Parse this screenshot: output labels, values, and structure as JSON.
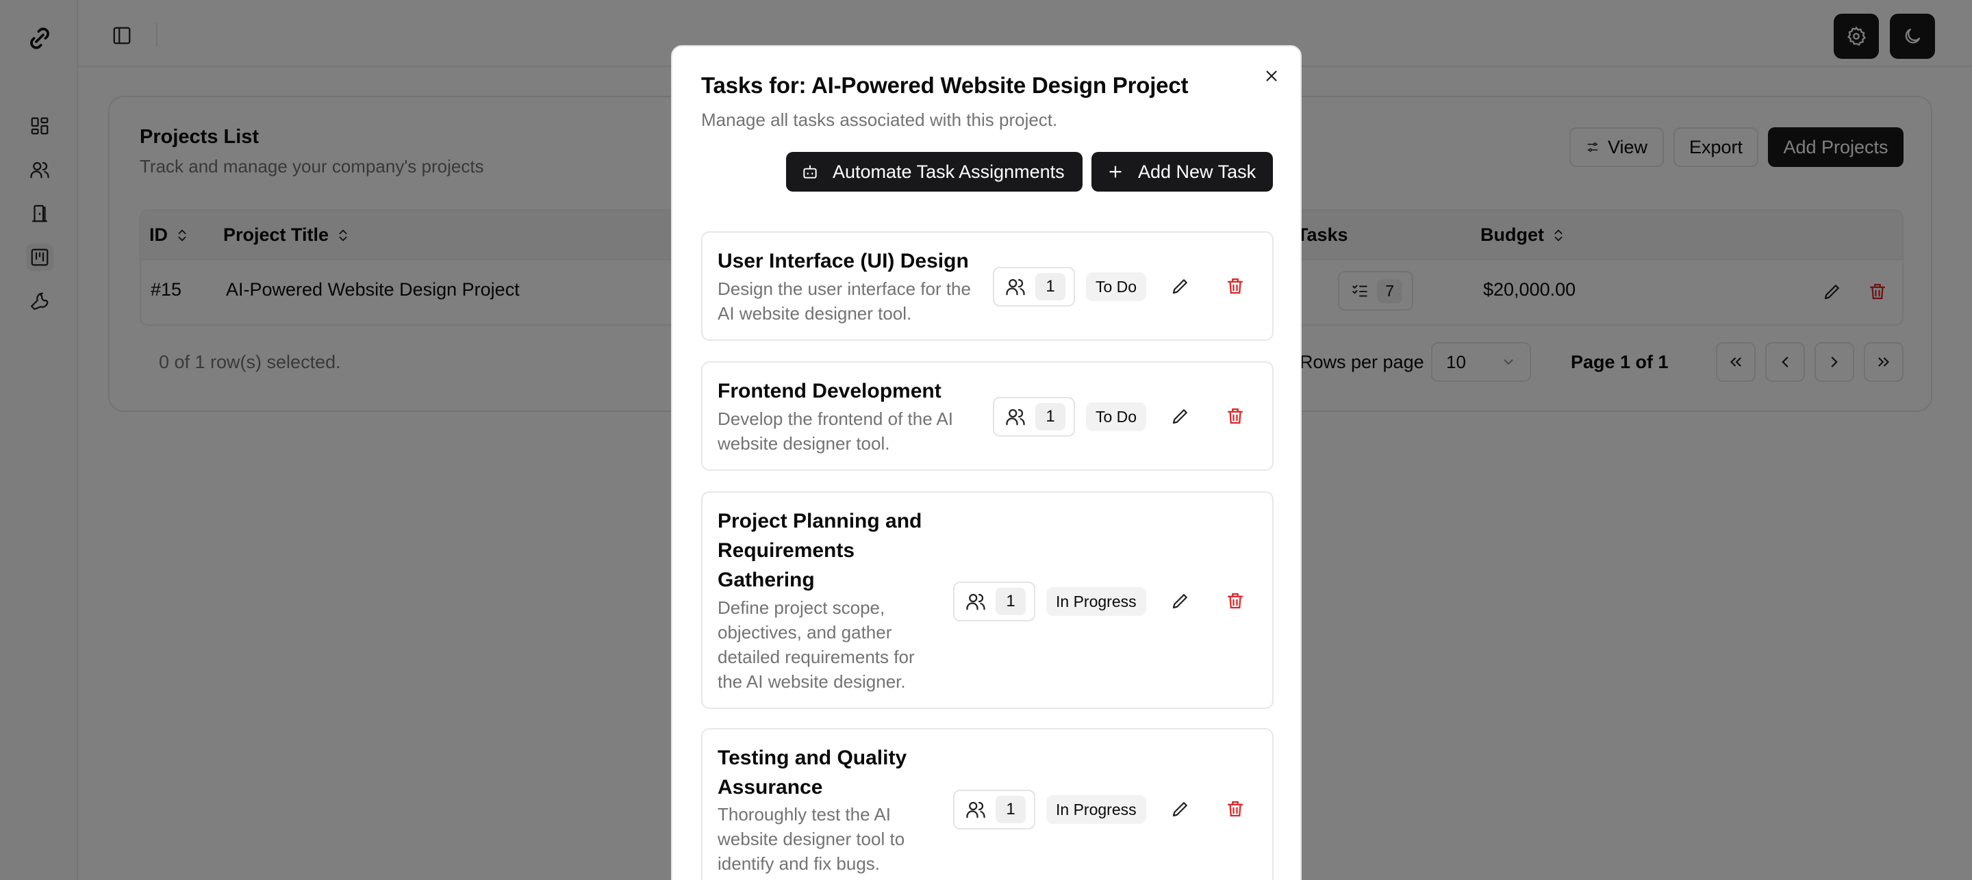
{
  "header": {
    "sidebar_toggle": "toggle-sidebar",
    "settings": "settings",
    "theme": "dark-mode"
  },
  "sidebar": {
    "items": [
      "dashboard",
      "users",
      "door",
      "kanban",
      "tools"
    ]
  },
  "projects": {
    "title": "Projects List",
    "subtitle": "Track and manage your company's projects",
    "view_label": "View",
    "export_label": "Export",
    "add_label": "Add Projects",
    "columns": {
      "id": "ID",
      "title": "Project Title",
      "tasks": "Tasks",
      "budget": "Budget"
    },
    "rows": [
      {
        "id": "#15",
        "title": "AI-Powered Website Design Project",
        "tasks": "7",
        "budget": "$20,000.00"
      }
    ],
    "selection": "0 of 1 row(s) selected.",
    "rows_per_page_label": "Rows per page",
    "rows_per_page_value": "10",
    "page_info": "Page 1 of 1"
  },
  "modal": {
    "title": "Tasks for: AI-Powered Website Design Project",
    "description": "Manage all tasks associated with this project.",
    "automate_label": "Automate Task Assignments",
    "add_task_label": "Add New Task",
    "tasks": [
      {
        "title": "User Interface (UI) Design",
        "description": "Design the user interface for the AI website designer tool.",
        "assignees": "1",
        "status": "To Do"
      },
      {
        "title": "Frontend Development",
        "description": "Develop the frontend of the AI website designer tool.",
        "assignees": "1",
        "status": "To Do"
      },
      {
        "title": "Project Planning and Requirements Gathering",
        "description": "Define project scope, objectives, and gather detailed requirements for the AI website designer.",
        "assignees": "1",
        "status": "In Progress"
      },
      {
        "title": "Testing and Quality Assurance",
        "description": "Thoroughly test the AI website designer tool to identify and fix bugs.",
        "assignees": "1",
        "status": "In Progress"
      }
    ]
  },
  "colors": {
    "danger": "#dc2626",
    "primary": "#18181b",
    "muted": "#737373"
  }
}
